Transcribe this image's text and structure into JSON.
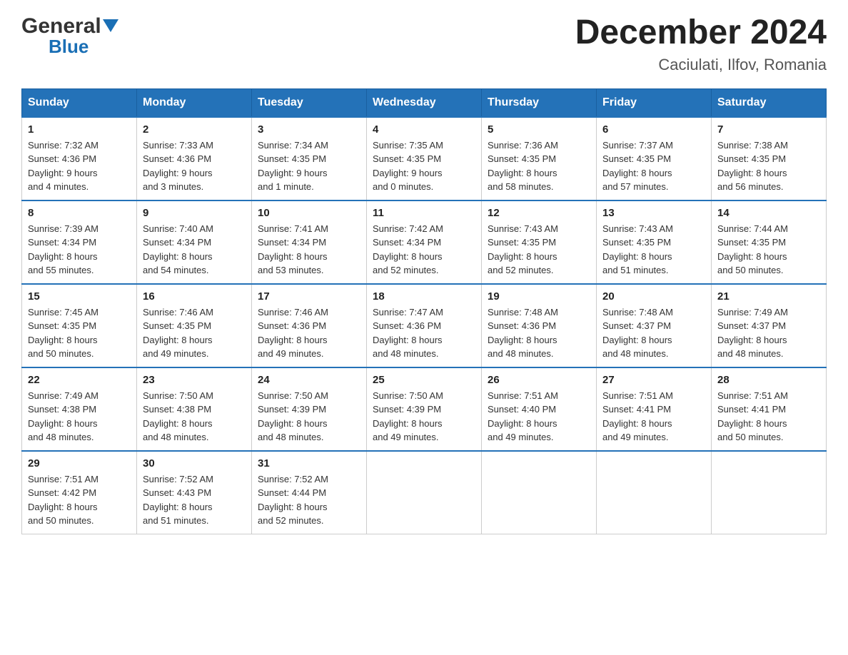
{
  "logo": {
    "general": "General",
    "blue": "Blue"
  },
  "title": "December 2024",
  "location": "Caciulati, Ilfov, Romania",
  "days_of_week": [
    "Sunday",
    "Monday",
    "Tuesday",
    "Wednesday",
    "Thursday",
    "Friday",
    "Saturday"
  ],
  "weeks": [
    [
      {
        "day": "1",
        "sunrise": "7:32 AM",
        "sunset": "4:36 PM",
        "daylight": "9 hours and 4 minutes."
      },
      {
        "day": "2",
        "sunrise": "7:33 AM",
        "sunset": "4:36 PM",
        "daylight": "9 hours and 3 minutes."
      },
      {
        "day": "3",
        "sunrise": "7:34 AM",
        "sunset": "4:35 PM",
        "daylight": "9 hours and 1 minute."
      },
      {
        "day": "4",
        "sunrise": "7:35 AM",
        "sunset": "4:35 PM",
        "daylight": "9 hours and 0 minutes."
      },
      {
        "day": "5",
        "sunrise": "7:36 AM",
        "sunset": "4:35 PM",
        "daylight": "8 hours and 58 minutes."
      },
      {
        "day": "6",
        "sunrise": "7:37 AM",
        "sunset": "4:35 PM",
        "daylight": "8 hours and 57 minutes."
      },
      {
        "day": "7",
        "sunrise": "7:38 AM",
        "sunset": "4:35 PM",
        "daylight": "8 hours and 56 minutes."
      }
    ],
    [
      {
        "day": "8",
        "sunrise": "7:39 AM",
        "sunset": "4:34 PM",
        "daylight": "8 hours and 55 minutes."
      },
      {
        "day": "9",
        "sunrise": "7:40 AM",
        "sunset": "4:34 PM",
        "daylight": "8 hours and 54 minutes."
      },
      {
        "day": "10",
        "sunrise": "7:41 AM",
        "sunset": "4:34 PM",
        "daylight": "8 hours and 53 minutes."
      },
      {
        "day": "11",
        "sunrise": "7:42 AM",
        "sunset": "4:34 PM",
        "daylight": "8 hours and 52 minutes."
      },
      {
        "day": "12",
        "sunrise": "7:43 AM",
        "sunset": "4:35 PM",
        "daylight": "8 hours and 52 minutes."
      },
      {
        "day": "13",
        "sunrise": "7:43 AM",
        "sunset": "4:35 PM",
        "daylight": "8 hours and 51 minutes."
      },
      {
        "day": "14",
        "sunrise": "7:44 AM",
        "sunset": "4:35 PM",
        "daylight": "8 hours and 50 minutes."
      }
    ],
    [
      {
        "day": "15",
        "sunrise": "7:45 AM",
        "sunset": "4:35 PM",
        "daylight": "8 hours and 50 minutes."
      },
      {
        "day": "16",
        "sunrise": "7:46 AM",
        "sunset": "4:35 PM",
        "daylight": "8 hours and 49 minutes."
      },
      {
        "day": "17",
        "sunrise": "7:46 AM",
        "sunset": "4:36 PM",
        "daylight": "8 hours and 49 minutes."
      },
      {
        "day": "18",
        "sunrise": "7:47 AM",
        "sunset": "4:36 PM",
        "daylight": "8 hours and 48 minutes."
      },
      {
        "day": "19",
        "sunrise": "7:48 AM",
        "sunset": "4:36 PM",
        "daylight": "8 hours and 48 minutes."
      },
      {
        "day": "20",
        "sunrise": "7:48 AM",
        "sunset": "4:37 PM",
        "daylight": "8 hours and 48 minutes."
      },
      {
        "day": "21",
        "sunrise": "7:49 AM",
        "sunset": "4:37 PM",
        "daylight": "8 hours and 48 minutes."
      }
    ],
    [
      {
        "day": "22",
        "sunrise": "7:49 AM",
        "sunset": "4:38 PM",
        "daylight": "8 hours and 48 minutes."
      },
      {
        "day": "23",
        "sunrise": "7:50 AM",
        "sunset": "4:38 PM",
        "daylight": "8 hours and 48 minutes."
      },
      {
        "day": "24",
        "sunrise": "7:50 AM",
        "sunset": "4:39 PM",
        "daylight": "8 hours and 48 minutes."
      },
      {
        "day": "25",
        "sunrise": "7:50 AM",
        "sunset": "4:39 PM",
        "daylight": "8 hours and 49 minutes."
      },
      {
        "day": "26",
        "sunrise": "7:51 AM",
        "sunset": "4:40 PM",
        "daylight": "8 hours and 49 minutes."
      },
      {
        "day": "27",
        "sunrise": "7:51 AM",
        "sunset": "4:41 PM",
        "daylight": "8 hours and 49 minutes."
      },
      {
        "day": "28",
        "sunrise": "7:51 AM",
        "sunset": "4:41 PM",
        "daylight": "8 hours and 50 minutes."
      }
    ],
    [
      {
        "day": "29",
        "sunrise": "7:51 AM",
        "sunset": "4:42 PM",
        "daylight": "8 hours and 50 minutes."
      },
      {
        "day": "30",
        "sunrise": "7:52 AM",
        "sunset": "4:43 PM",
        "daylight": "8 hours and 51 minutes."
      },
      {
        "day": "31",
        "sunrise": "7:52 AM",
        "sunset": "4:44 PM",
        "daylight": "8 hours and 52 minutes."
      },
      null,
      null,
      null,
      null
    ]
  ],
  "labels": {
    "sunrise": "Sunrise:",
    "sunset": "Sunset:",
    "daylight": "Daylight:"
  },
  "colors": {
    "header_bg": "#2472b8",
    "header_text": "#ffffff",
    "border_top": "#2472b8",
    "cell_border": "#cccccc"
  }
}
